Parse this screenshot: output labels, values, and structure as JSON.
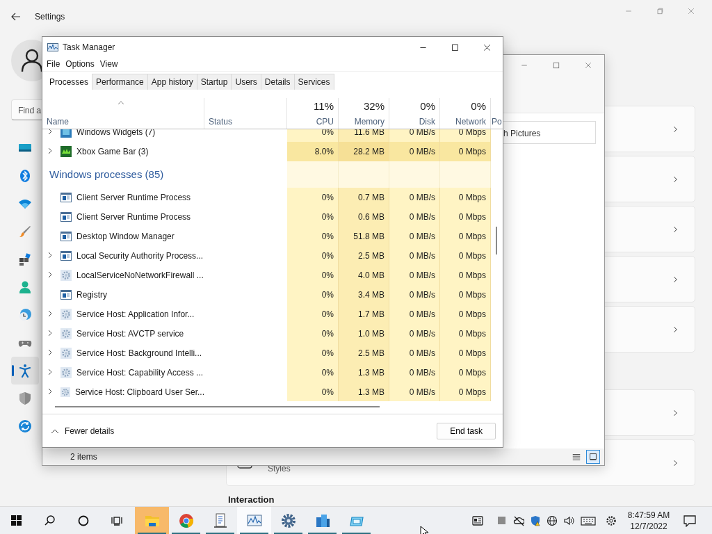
{
  "settings": {
    "title": "Settings",
    "search_text": "Find a",
    "nav": [
      {
        "kind": "display",
        "selected": false
      },
      {
        "kind": "bluetooth",
        "selected": false
      },
      {
        "kind": "wifi",
        "selected": false
      },
      {
        "kind": "brush",
        "selected": false
      },
      {
        "kind": "apps",
        "selected": false
      },
      {
        "kind": "person",
        "selected": false
      },
      {
        "kind": "clock",
        "selected": false
      },
      {
        "kind": "gamepad",
        "selected": false
      },
      {
        "kind": "accessibility",
        "selected": true
      },
      {
        "kind": "shield",
        "selected": false
      },
      {
        "kind": "update",
        "selected": false
      }
    ],
    "card_subtitle": "Styles",
    "section_heading": "Interaction"
  },
  "explorer": {
    "search_text": "h Pictures",
    "status": "2 items",
    "views": [
      {
        "kind": "details",
        "selected": false
      },
      {
        "kind": "tiles",
        "selected": true
      }
    ]
  },
  "task_manager": {
    "title": "Task Manager",
    "menu": [
      "File",
      "Options",
      "View"
    ],
    "tabs": [
      {
        "label": "Processes",
        "selected": true
      },
      {
        "label": "Performance",
        "selected": false
      },
      {
        "label": "App history",
        "selected": false
      },
      {
        "label": "Startup",
        "selected": false
      },
      {
        "label": "Users",
        "selected": false
      },
      {
        "label": "Details",
        "selected": false
      },
      {
        "label": "Services",
        "selected": false
      }
    ],
    "columns": [
      {
        "label": "Name",
        "sorted": true
      },
      {
        "label": "Status",
        "sorted": false
      },
      {
        "label": "CPU",
        "total": "11%",
        "sorted": false
      },
      {
        "label": "Memory",
        "total": "32%",
        "sorted": false
      },
      {
        "label": "Disk",
        "total": "0%",
        "sorted": false
      },
      {
        "label": "Network",
        "total": "0%",
        "sorted": false
      },
      {
        "label": "Po",
        "sorted": false
      }
    ],
    "rows": [
      {
        "kind": "widgets",
        "name": "Windows Widgets (7)",
        "expandable": true,
        "busy": false,
        "cpu": "0%",
        "memory": "11.6 MB",
        "disk": "0 MB/s",
        "network": "0 Mbps"
      },
      {
        "kind": "xbox",
        "name": "Xbox Game Bar (3)",
        "expandable": true,
        "busy": true,
        "cpu": "8.0%",
        "memory": "28.2 MB",
        "disk": "0 MB/s",
        "network": "0 Mbps"
      },
      {
        "kind": "group",
        "name": "Windows processes (85)"
      },
      {
        "kind": "window",
        "name": "Client Server Runtime Process",
        "expandable": false,
        "busy": false,
        "cpu": "0%",
        "memory": "0.7 MB",
        "disk": "0 MB/s",
        "network": "0 Mbps"
      },
      {
        "kind": "window",
        "name": "Client Server Runtime Process",
        "expandable": false,
        "busy": false,
        "cpu": "0%",
        "memory": "0.6 MB",
        "disk": "0 MB/s",
        "network": "0 Mbps"
      },
      {
        "kind": "window",
        "name": "Desktop Window Manager",
        "expandable": false,
        "busy": false,
        "cpu": "0%",
        "memory": "51.8 MB",
        "disk": "0 MB/s",
        "network": "0 Mbps"
      },
      {
        "kind": "window",
        "name": "Local Security Authority Process...",
        "expandable": true,
        "busy": false,
        "cpu": "0%",
        "memory": "2.5 MB",
        "disk": "0 MB/s",
        "network": "0 Mbps"
      },
      {
        "kind": "service",
        "name": "LocalServiceNoNetworkFirewall ...",
        "expandable": true,
        "busy": false,
        "cpu": "0%",
        "memory": "4.0 MB",
        "disk": "0 MB/s",
        "network": "0 Mbps"
      },
      {
        "kind": "window",
        "name": "Registry",
        "expandable": false,
        "busy": false,
        "cpu": "0%",
        "memory": "3.4 MB",
        "disk": "0 MB/s",
        "network": "0 Mbps"
      },
      {
        "kind": "service",
        "name": "Service Host: Application Infor...",
        "expandable": true,
        "busy": false,
        "cpu": "0%",
        "memory": "1.7 MB",
        "disk": "0 MB/s",
        "network": "0 Mbps"
      },
      {
        "kind": "service",
        "name": "Service Host: AVCTP service",
        "expandable": true,
        "busy": false,
        "cpu": "0%",
        "memory": "1.0 MB",
        "disk": "0 MB/s",
        "network": "0 Mbps"
      },
      {
        "kind": "service",
        "name": "Service Host: Background Intelli...",
        "expandable": true,
        "busy": false,
        "cpu": "0%",
        "memory": "2.5 MB",
        "disk": "0 MB/s",
        "network": "0 Mbps"
      },
      {
        "kind": "service",
        "name": "Service Host: Capability Access ...",
        "expandable": true,
        "busy": false,
        "cpu": "0%",
        "memory": "1.3 MB",
        "disk": "0 MB/s",
        "network": "0 Mbps"
      },
      {
        "kind": "service",
        "name": "Service Host: Clipboard User Ser...",
        "expandable": true,
        "busy": false,
        "cpu": "0%",
        "memory": "1.3 MB",
        "disk": "0 MB/s",
        "network": "0 Mbps"
      }
    ],
    "fewer_details": "Fewer details",
    "end_task": "End task"
  },
  "taskbar": {
    "apps": [
      {
        "kind": "explorer",
        "running": true,
        "selected": false,
        "flashing": true
      },
      {
        "kind": "chrome",
        "running": true,
        "selected": false,
        "flashing": false
      },
      {
        "kind": "document",
        "running": true,
        "selected": false,
        "flashing": false
      },
      {
        "kind": "monitor",
        "running": true,
        "selected": true,
        "flashing": false
      },
      {
        "kind": "gear",
        "running": true,
        "selected": false,
        "flashing": false
      },
      {
        "kind": "blocks",
        "running": true,
        "selected": false,
        "flashing": false
      },
      {
        "kind": "window",
        "running": true,
        "selected": false,
        "flashing": false
      }
    ],
    "tray": [
      {
        "kind": "news"
      },
      {
        "kind": "square"
      },
      {
        "kind": "cloud"
      },
      {
        "kind": "shield"
      },
      {
        "kind": "globe"
      },
      {
        "kind": "speaker"
      },
      {
        "kind": "keyboard"
      },
      {
        "kind": "gear"
      }
    ],
    "time": "8:47:59 AM",
    "date": "12/7/2022"
  }
}
